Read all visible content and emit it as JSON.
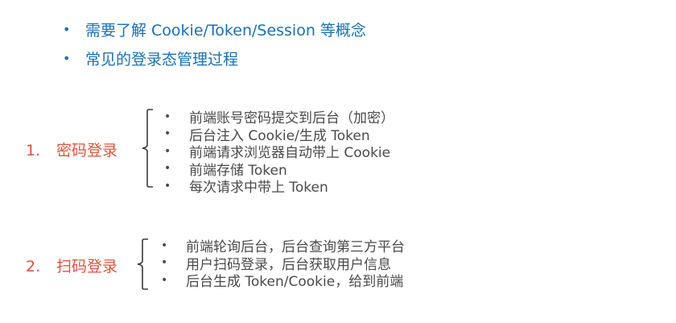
{
  "top_bullets": [
    "需要了解 Cookie/Token/Session 等概念",
    "常见的登录态管理过程"
  ],
  "bullet_glyph": "•",
  "sections": [
    {
      "number": "1.",
      "title": "密码登录",
      "items": [
        "前端账号密码提交到后台（加密）",
        "后台注入 Cookie/生成 Token",
        "前端请求浏览器自动带上 Cookie",
        "前端存储 Token",
        "每次请求中带上 Token"
      ]
    },
    {
      "number": "2.",
      "title": "扫码登录",
      "items": [
        "前端轮询后台，后台查询第三方平台",
        "用户扫码登录，后台获取用户信息",
        "后台生成 Token/Cookie，给到前端"
      ]
    }
  ],
  "colors": {
    "top_text": "#1c6fb5",
    "section_title": "#e0533d",
    "body_text": "#4a4a4a",
    "brace": "#3a3a3a"
  }
}
